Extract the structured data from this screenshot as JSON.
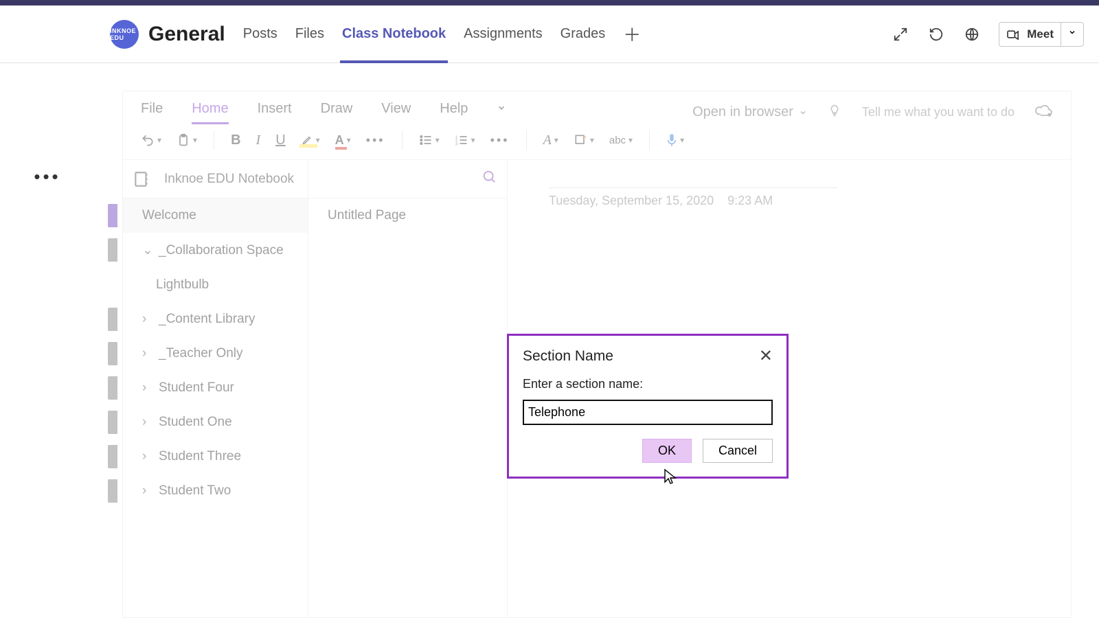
{
  "team": {
    "badge_text": "INKNOE EDU"
  },
  "channel": {
    "name": "General"
  },
  "header_tabs": {
    "posts": "Posts",
    "files": "Files",
    "class_notebook": "Class Notebook",
    "assignments": "Assignments",
    "grades": "Grades"
  },
  "meet_label": "Meet",
  "onenote": {
    "ribbon": {
      "file": "File",
      "home": "Home",
      "insert": "Insert",
      "draw": "Draw",
      "view": "View",
      "help": "Help",
      "open_in_browser": "Open in browser",
      "tell_me": "Tell me what you want to do"
    },
    "notebook_title": "Inknoe EDU Notebook",
    "sections": [
      {
        "label": "Welcome",
        "expandable": false,
        "selected": true
      },
      {
        "label": "_Collaboration Space",
        "expandable": true,
        "expanded": true
      },
      {
        "label": "Lightbulb",
        "child": true
      },
      {
        "label": "_Content Library",
        "expandable": true
      },
      {
        "label": "_Teacher Only",
        "expandable": true
      },
      {
        "label": "Student Four",
        "expandable": true
      },
      {
        "label": "Student One",
        "expandable": true
      },
      {
        "label": "Student Three",
        "expandable": true
      },
      {
        "label": "Student Two",
        "expandable": true
      }
    ],
    "pages": [
      {
        "label": "Untitled Page"
      }
    ],
    "page_meta": {
      "date": "Tuesday, September 15, 2020",
      "time": "9:23 AM"
    }
  },
  "dialog": {
    "title": "Section Name",
    "prompt": "Enter a section name:",
    "value": "Telephone",
    "ok": "OK",
    "cancel": "Cancel"
  }
}
